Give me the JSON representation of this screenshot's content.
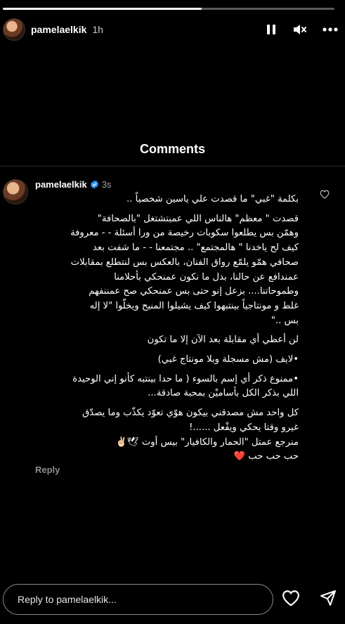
{
  "story": {
    "progress": 0.6,
    "username": "pamelaelkik",
    "time": "1h",
    "icons": [
      "pause-icon",
      "mute-icon",
      "more-icon"
    ]
  },
  "comments_title": "Comments",
  "comment": {
    "username": "pamelaelkik",
    "verified": true,
    "age": "3s",
    "lines": [
      "بكلمة \"غبي\" ما قصدت علي ياسين شخصياً ..",
      "قصدت \" معظم\" هالناس اللي عمبتشتغل \"بالصحافة\"",
      "وهمّن بس يطلعوا سكوبات رخيصة من ورا أسئلة - - معروفة",
      "كيف لح ياخدنا \" هالمجتمع\" .. مجتمعنا - - ما شفت بعد",
      "صحافي همّو يلمّع رواق الفنان، بالعكس بس لنتطلع بمقابلات",
      "عمندافع عن حالنا، بدل ما نكون عمنحكي بأحلامنا",
      "وطموحاتنا.... بزعل إنو حتى بس عمنحكي صح عمننفهم",
      "غلط و مونتاجياً بينتبهوا كيف يشيلوا المنيح ويخلّوا \"لا إله",
      "بس ..\"",
      "لن أعطي أي مقابلة بعد الآن إلا ما تكون",
      "•لايف (مش مسجلة وبلا مونتاج غبي)",
      "•ممنوع ذكر أي إسم بالسوء ( ما حدا بينتبه كأنو إني الوحيدة",
      "اللي بذكر الكل بأساميْن بمحبة صادقة...",
      "كل واحد مش مصدقني بيكون هوّي تعوّد يكذّب وما يصدّق",
      "غيرو وقتا يحكي ويفْعل ......!",
      "منرجع عمتل \"الحمار والكافيار\" بيس أوت 🕊✌🏻",
      "حب حب حب ❤️"
    ],
    "reply_label": "Reply"
  },
  "footer": {
    "reply_placeholder": "Reply to pamelaelkik..."
  }
}
